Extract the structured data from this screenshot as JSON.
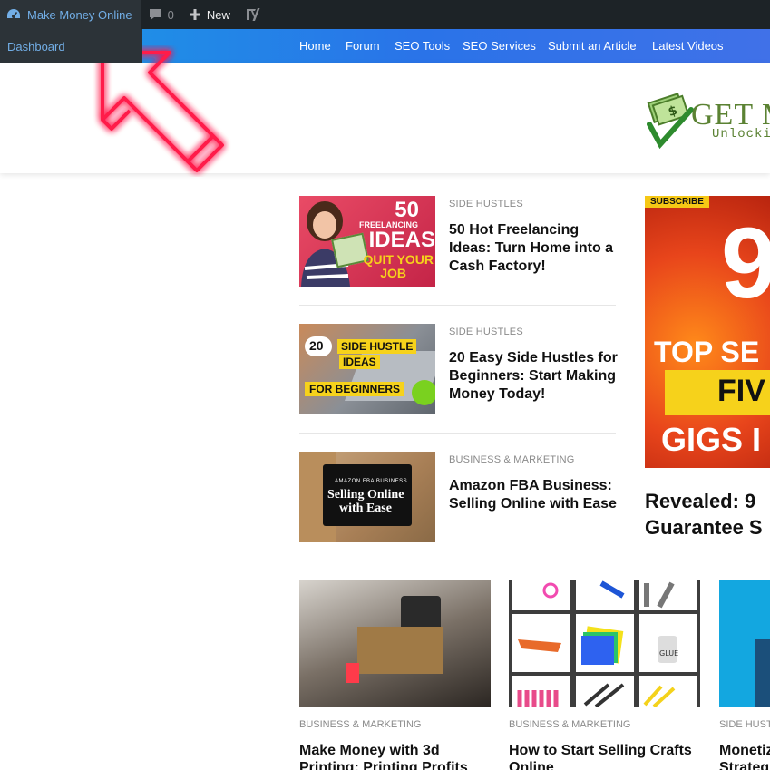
{
  "adminbar": {
    "site_name": "Make Money Online",
    "comment_count": "0",
    "new_label": "New",
    "dropdown_item": "Dashboard",
    "icons": [
      "dashboard-icon",
      "comment-icon",
      "plus-icon",
      "yoast-icon"
    ]
  },
  "nav": {
    "items": [
      "Home",
      "Forum",
      "SEO Tools",
      "SEO Services",
      "Submit an Article",
      "Latest Videos"
    ]
  },
  "logo": {
    "text": "GET M",
    "tagline": "Unlockin"
  },
  "posts": [
    {
      "category": "SIDE HUSTLES",
      "title": "50 Hot Freelancing Ideas: Turn Home into a Cash Factory!",
      "thumb_lines": [
        "50",
        "FREELANCING",
        "IDEAS",
        "QUIT YOUR",
        "JOB"
      ]
    },
    {
      "category": "SIDE HUSTLES",
      "title": "20 Easy Side Hustles for Beginners: Start Making Money Today!",
      "thumb_lines": [
        "20",
        "SIDE HUSTLE",
        "IDEAS",
        "FOR BEGINNERS"
      ]
    },
    {
      "category": "BUSINESS & MARKETING",
      "title": "Amazon FBA Business: Selling Online with Ease",
      "thumb_lines": [
        "AMAZON FBA BUSINESS",
        "Selling Online",
        "with Ease"
      ]
    }
  ],
  "featured": {
    "badge": "SUBSCRIBE",
    "thumb_lines": [
      "9",
      "TOP SE",
      "FIV",
      "GIGS I"
    ],
    "title_line1": "Revealed: 9",
    "title_line2": "Guarantee S"
  },
  "grid": [
    {
      "category": "BUSINESS & MARKETING",
      "title_line1": "Make Money with 3d",
      "title_line2": "Printing: Printing Profits"
    },
    {
      "category": "BUSINESS & MARKETING",
      "title_line1": "How to Start Selling Crafts",
      "title_line2": "Online"
    },
    {
      "category": "SIDE HUST",
      "title_line1": "Monetiz",
      "title_line2": "Strateg"
    }
  ],
  "colors": {
    "adminbar": "#1d2327",
    "admin_link": "#72aee6",
    "nav_start": "#1a9be6",
    "nav_end": "#4071e8",
    "arrow": "#ff1a4a",
    "logo_green": "#5b8233"
  }
}
